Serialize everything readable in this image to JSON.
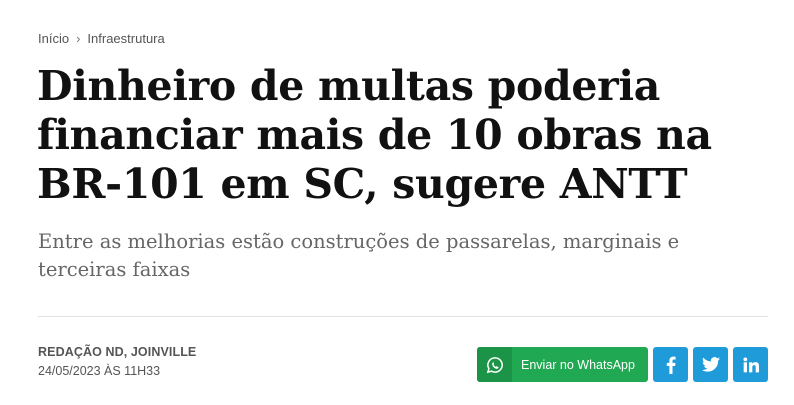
{
  "breadcrumb": {
    "home": "Início",
    "separator": "›",
    "section": "Infraestrutura"
  },
  "article": {
    "title": "Dinheiro de multas poderia financiar mais de 10 obras na BR-101 em SC, sugere ANTT",
    "subtitle": "Entre as melhorias estão construções de passarelas, marginais e terceiras faixas",
    "author": "REDAÇÃO ND, JOINVILLE",
    "date": "24/05/2023 ÀS 11H33"
  },
  "share": {
    "whatsapp_label": "Enviar no WhatsApp",
    "icons": [
      "whatsapp-icon",
      "facebook-icon",
      "twitter-icon",
      "linkedin-icon"
    ]
  },
  "colors": {
    "whatsapp": "#20a852",
    "social": "#1f9bd9"
  }
}
